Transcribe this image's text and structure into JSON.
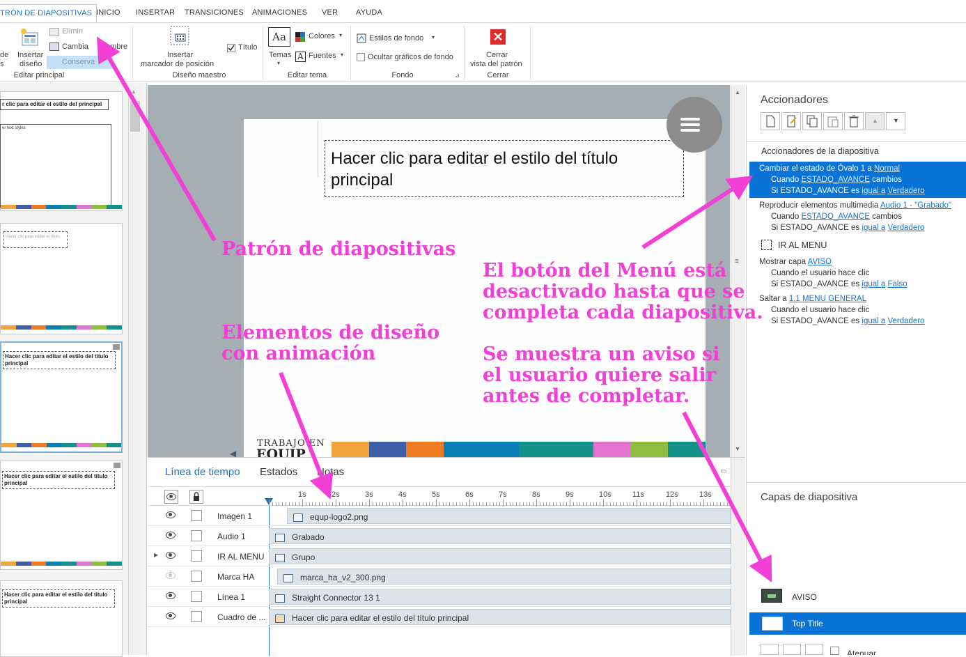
{
  "tabs": [
    "TRÓN DE DIAPOSITIVAS",
    "INICIO",
    "INSERTAR",
    "TRANSICIONES",
    "ANIMACIONES",
    "VER",
    "AYUDA"
  ],
  "ribbon": {
    "insert_design_l1": "Insertar",
    "insert_design_l2": "diseño",
    "de_frag": "de",
    "s_frag": "s",
    "eliminar": "Elimin",
    "cambiar": "Cambia",
    "nombre": "ombre",
    "conservar": "Conserva",
    "group_editar_principal": "Editar principal",
    "placeholder_l1": "Insertar",
    "placeholder_l2": "marcador de posición",
    "titulo": "Título",
    "group_diseno_maestro": "Diseño maestro",
    "temas": "Temas",
    "temas_icon": "Aa",
    "colores": "Colores",
    "fuentes": "Fuentes",
    "group_editar_tema": "Editar tema",
    "estilos_fondo": "Estilos de fondo",
    "ocultar_graficos": "Ocultar gráficos de fondo",
    "group_fondo": "Fondo",
    "cerrar_l1": "Cerrar",
    "cerrar_l2": "vista del patrón",
    "group_cerrar": "Cerrar"
  },
  "thumbnails": {
    "title_1": "r clic para editar el estilo del principal",
    "text_styles": "er text styles",
    "placeholder_2": "Hacer clic para editar el título",
    "title_3": "Hacer clic para editar el estilo del título principal",
    "title_4": "Hacer clic para editar el estilo del título principal",
    "title_5": "Hacer clic para editar el estilo del título principal"
  },
  "slide": {
    "title_line1": "Hacer clic para editar el estilo del título",
    "title_line2": "principal",
    "logo_line1": "TRABAJO EN",
    "logo_line2": "EQUIP",
    "color_strip": [
      "#f0a53c",
      "#3f5ea8",
      "#ee7a22",
      "#0a7fb5",
      "#0a7fb5",
      "#14918a",
      "#14918a",
      "#e274cf",
      "#8fbd3f",
      "#14918a"
    ]
  },
  "timeline": {
    "tabs": [
      "Línea de tiempo",
      "Estados",
      "Notas"
    ],
    "ruler": [
      "1s",
      "2s",
      "3s",
      "4s",
      "5s",
      "6s",
      "7s",
      "8s",
      "9s",
      "10s",
      "11s",
      "12s",
      "13s"
    ],
    "rows": [
      {
        "name": "Imagen 1",
        "bar": "equp-logo2.png"
      },
      {
        "name": "Audio 1",
        "bar": "Grabado"
      },
      {
        "name": "IR AL MENU",
        "bar": "Grupo"
      },
      {
        "name": "Marca HA",
        "bar": "marca_ha_v2_300.png"
      },
      {
        "name": "Línea 1",
        "bar": "Straight Connector 13 1"
      },
      {
        "name": "Cuadro de ...",
        "bar": "Hacer clic para editar el estilo del título principal"
      }
    ]
  },
  "triggers_panel": {
    "title": "Accionadores",
    "section": "Accionadores de la diapositiva",
    "t1": {
      "action": "Cambiar el estado de Óvalo 1",
      "a": "a",
      "state": "Normal",
      "cuando": "Cuando",
      "var": "ESTADO_AVANCE",
      "cambios": "cambios",
      "si": "Si ESTADO_AVANCE es",
      "op": "igual a",
      "val": "Verdadero"
    },
    "t2": {
      "action": "Reproducir elementos multimedia",
      "media": "Audio 1 - \"Grabado\"",
      "cuando": "Cuando",
      "var": "ESTADO_AVANCE",
      "cambios": "cambios",
      "si": "Si ESTADO_AVANCE es",
      "op": "igual a",
      "val": "Verdadero"
    },
    "group": "IR AL MENU",
    "t3": {
      "action": "Mostrar capa",
      "layer": "AVISO",
      "cuando": "Cuando el usuario hace clic",
      "si": "Si ESTADO_AVANCE es",
      "op": "igual a",
      "val": "Falso"
    },
    "t4": {
      "action": "Saltar a",
      "target": "1.1 MENU GENERAL",
      "cuando": "Cuando el usuario hace clic",
      "si": "Si ESTADO_AVANCE es",
      "op": "igual a",
      "val": "Verdadero"
    }
  },
  "layers_panel": {
    "title": "Capas de diapositiva",
    "layers": [
      "AVISO",
      "Top Title"
    ],
    "atenuar": "Atenuar"
  },
  "annotations": {
    "a1": "Patrón de diapositivas",
    "a2_l1": "Elementos de diseño",
    "a2_l2": "con animación",
    "a3_l1": "El botón del Menú está",
    "a3_l2": "desactivado hasta que se",
    "a3_l3": "completa cada diapositiva.",
    "a4_l1": "Se muestra un aviso si",
    "a4_l2": "el usuario quiere salir",
    "a4_l3": "antes de completar.",
    "color": "#f23fd6"
  },
  "colors": {
    "accent": "#0a73d8",
    "link": "#1a73c9"
  }
}
